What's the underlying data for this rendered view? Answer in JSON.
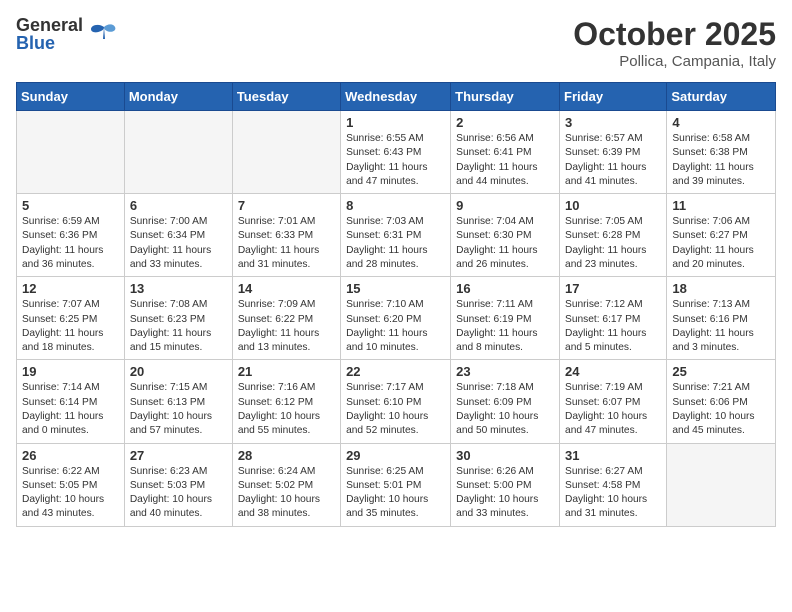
{
  "header": {
    "logo_general": "General",
    "logo_blue": "Blue",
    "month_title": "October 2025",
    "subtitle": "Pollica, Campania, Italy"
  },
  "days_of_week": [
    "Sunday",
    "Monday",
    "Tuesday",
    "Wednesday",
    "Thursday",
    "Friday",
    "Saturday"
  ],
  "weeks": [
    [
      {
        "num": "",
        "info": ""
      },
      {
        "num": "",
        "info": ""
      },
      {
        "num": "",
        "info": ""
      },
      {
        "num": "1",
        "info": "Sunrise: 6:55 AM\nSunset: 6:43 PM\nDaylight: 11 hours and 47 minutes."
      },
      {
        "num": "2",
        "info": "Sunrise: 6:56 AM\nSunset: 6:41 PM\nDaylight: 11 hours and 44 minutes."
      },
      {
        "num": "3",
        "info": "Sunrise: 6:57 AM\nSunset: 6:39 PM\nDaylight: 11 hours and 41 minutes."
      },
      {
        "num": "4",
        "info": "Sunrise: 6:58 AM\nSunset: 6:38 PM\nDaylight: 11 hours and 39 minutes."
      }
    ],
    [
      {
        "num": "5",
        "info": "Sunrise: 6:59 AM\nSunset: 6:36 PM\nDaylight: 11 hours and 36 minutes."
      },
      {
        "num": "6",
        "info": "Sunrise: 7:00 AM\nSunset: 6:34 PM\nDaylight: 11 hours and 33 minutes."
      },
      {
        "num": "7",
        "info": "Sunrise: 7:01 AM\nSunset: 6:33 PM\nDaylight: 11 hours and 31 minutes."
      },
      {
        "num": "8",
        "info": "Sunrise: 7:03 AM\nSunset: 6:31 PM\nDaylight: 11 hours and 28 minutes."
      },
      {
        "num": "9",
        "info": "Sunrise: 7:04 AM\nSunset: 6:30 PM\nDaylight: 11 hours and 26 minutes."
      },
      {
        "num": "10",
        "info": "Sunrise: 7:05 AM\nSunset: 6:28 PM\nDaylight: 11 hours and 23 minutes."
      },
      {
        "num": "11",
        "info": "Sunrise: 7:06 AM\nSunset: 6:27 PM\nDaylight: 11 hours and 20 minutes."
      }
    ],
    [
      {
        "num": "12",
        "info": "Sunrise: 7:07 AM\nSunset: 6:25 PM\nDaylight: 11 hours and 18 minutes."
      },
      {
        "num": "13",
        "info": "Sunrise: 7:08 AM\nSunset: 6:23 PM\nDaylight: 11 hours and 15 minutes."
      },
      {
        "num": "14",
        "info": "Sunrise: 7:09 AM\nSunset: 6:22 PM\nDaylight: 11 hours and 13 minutes."
      },
      {
        "num": "15",
        "info": "Sunrise: 7:10 AM\nSunset: 6:20 PM\nDaylight: 11 hours and 10 minutes."
      },
      {
        "num": "16",
        "info": "Sunrise: 7:11 AM\nSunset: 6:19 PM\nDaylight: 11 hours and 8 minutes."
      },
      {
        "num": "17",
        "info": "Sunrise: 7:12 AM\nSunset: 6:17 PM\nDaylight: 11 hours and 5 minutes."
      },
      {
        "num": "18",
        "info": "Sunrise: 7:13 AM\nSunset: 6:16 PM\nDaylight: 11 hours and 3 minutes."
      }
    ],
    [
      {
        "num": "19",
        "info": "Sunrise: 7:14 AM\nSunset: 6:14 PM\nDaylight: 11 hours and 0 minutes."
      },
      {
        "num": "20",
        "info": "Sunrise: 7:15 AM\nSunset: 6:13 PM\nDaylight: 10 hours and 57 minutes."
      },
      {
        "num": "21",
        "info": "Sunrise: 7:16 AM\nSunset: 6:12 PM\nDaylight: 10 hours and 55 minutes."
      },
      {
        "num": "22",
        "info": "Sunrise: 7:17 AM\nSunset: 6:10 PM\nDaylight: 10 hours and 52 minutes."
      },
      {
        "num": "23",
        "info": "Sunrise: 7:18 AM\nSunset: 6:09 PM\nDaylight: 10 hours and 50 minutes."
      },
      {
        "num": "24",
        "info": "Sunrise: 7:19 AM\nSunset: 6:07 PM\nDaylight: 10 hours and 47 minutes."
      },
      {
        "num": "25",
        "info": "Sunrise: 7:21 AM\nSunset: 6:06 PM\nDaylight: 10 hours and 45 minutes."
      }
    ],
    [
      {
        "num": "26",
        "info": "Sunrise: 6:22 AM\nSunset: 5:05 PM\nDaylight: 10 hours and 43 minutes."
      },
      {
        "num": "27",
        "info": "Sunrise: 6:23 AM\nSunset: 5:03 PM\nDaylight: 10 hours and 40 minutes."
      },
      {
        "num": "28",
        "info": "Sunrise: 6:24 AM\nSunset: 5:02 PM\nDaylight: 10 hours and 38 minutes."
      },
      {
        "num": "29",
        "info": "Sunrise: 6:25 AM\nSunset: 5:01 PM\nDaylight: 10 hours and 35 minutes."
      },
      {
        "num": "30",
        "info": "Sunrise: 6:26 AM\nSunset: 5:00 PM\nDaylight: 10 hours and 33 minutes."
      },
      {
        "num": "31",
        "info": "Sunrise: 6:27 AM\nSunset: 4:58 PM\nDaylight: 10 hours and 31 minutes."
      },
      {
        "num": "",
        "info": ""
      }
    ]
  ]
}
